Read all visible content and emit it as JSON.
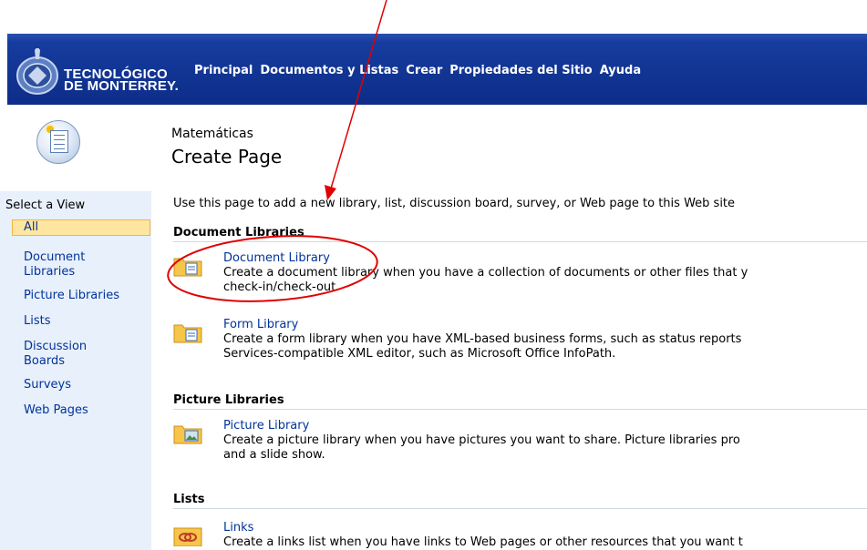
{
  "logo": {
    "line1": "TECNOLÓGICO",
    "line2": "DE MONTERREY."
  },
  "nav": [
    "Principal",
    "Documentos y Listas",
    "Crear",
    "Propiedades del Sitio",
    "Ayuda"
  ],
  "header": {
    "site": "Matemáticas",
    "title": "Create Page"
  },
  "sidebar": {
    "title": "Select a View",
    "selected": "All",
    "items": [
      "Document Libraries",
      "Picture Libraries",
      "Lists",
      "Discussion Boards",
      "Surveys",
      "Web Pages"
    ]
  },
  "intro": "Use this page to add a new library, list, discussion board, survey, or Web page to this Web site",
  "sections": {
    "doclib": "Document Libraries",
    "piclib": "Picture Libraries",
    "lists": "Lists"
  },
  "entries": {
    "document_library": {
      "name": "Document Library",
      "desc1": "Create a document library when you have a collection of documents or other files that y",
      "desc2": "check-in/check-out."
    },
    "form_library": {
      "name": "Form Library",
      "desc1": "Create a form library when you have XML-based business forms, such as status reports",
      "desc2": "Services-compatible XML editor, such as Microsoft Office InfoPath."
    },
    "picture_library": {
      "name": "Picture Library",
      "desc1": "Create a picture library when you have pictures you want to share.  Picture libraries pro",
      "desc2": "and a slide show."
    },
    "links": {
      "name": "Links",
      "desc1": "Create a links list when you have links to Web pages or other resources that you want t"
    }
  },
  "colors": {
    "banner": "#0d2d88",
    "link": "#003399",
    "sidebar_bg": "#e8f0fb",
    "selected_bg": "#ffe6a0",
    "annotation": "#e00000"
  }
}
